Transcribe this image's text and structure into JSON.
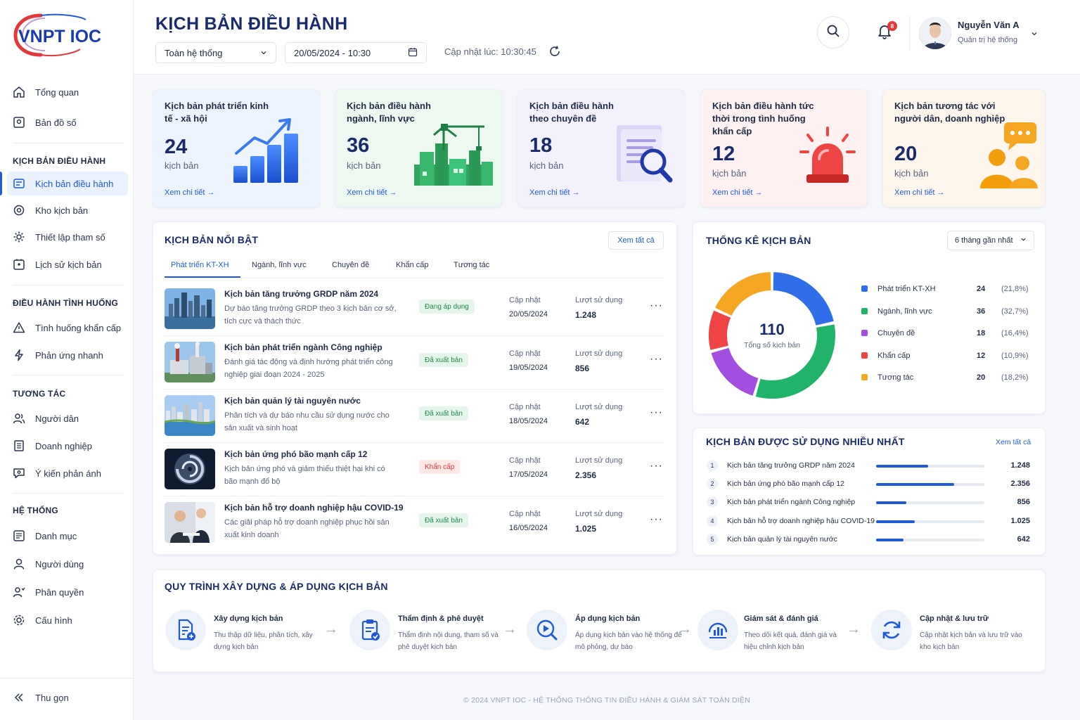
{
  "brand": {
    "logo_text": "VNPT IOC",
    "colors": {
      "primary": "#1f5bd8",
      "navy": "#1a2b6b",
      "logo_red": "#e5383b",
      "green": "#22b36b",
      "purple": "#a24fe0",
      "red": "#ef4444",
      "orange": "#f5a623"
    }
  },
  "sidebar": {
    "items_top": [
      {
        "label": "Tổng quan",
        "icon": "home-icon"
      },
      {
        "label": "Bản đồ số",
        "icon": "map-icon"
      }
    ],
    "sections": [
      {
        "title": "KỊCH BẢN ĐIỀU HÀNH",
        "items": [
          {
            "label": "Kịch bản điều hành",
            "icon": "scenario-icon",
            "active": true
          },
          {
            "label": "Kho kịch bản",
            "icon": "archive-icon"
          },
          {
            "label": "Thiết lập tham số",
            "icon": "settings-icon"
          },
          {
            "label": "Lịch sử kịch bản",
            "icon": "history-icon"
          }
        ]
      },
      {
        "title": "ĐIỀU HÀNH TÌNH HUỐNG",
        "items": [
          {
            "label": "Tình huống khẩn cấp",
            "icon": "warning-icon"
          },
          {
            "label": "Phản ứng nhanh",
            "icon": "lightning-icon"
          }
        ]
      },
      {
        "title": "TƯƠNG TÁC",
        "items": [
          {
            "label": "Người dân",
            "icon": "users-icon"
          },
          {
            "label": "Doanh nghiệp",
            "icon": "building-icon"
          },
          {
            "label": "Ý kiến phản ánh",
            "icon": "feedback-icon"
          }
        ]
      },
      {
        "title": "HỆ THỐNG",
        "items": [
          {
            "label": "Danh mục",
            "icon": "list-icon"
          },
          {
            "label": "Người dùng",
            "icon": "user-icon"
          },
          {
            "label": "Phân quyền",
            "icon": "permission-icon"
          },
          {
            "label": "Cấu hình",
            "icon": "gear-icon"
          }
        ]
      }
    ],
    "collapse_label": "Thu gọn"
  },
  "header": {
    "title": "KỊCH BẢN ĐIỀU HÀNH",
    "scope_select": "Toàn hệ thống",
    "datetime": "20/05/2024 - 10:30",
    "updated_text": "Cập nhật lúc: 10:30:45",
    "notification_count": "8",
    "user": {
      "name": "Nguyễn Văn A",
      "role": "Quản trị hệ thống"
    }
  },
  "stat_cards": [
    {
      "title": "Kịch bản phát triển kinh tế - xã hội",
      "value": "24",
      "unit": "kịch bản",
      "link": "Xem chi tiết",
      "bg": "#eef4fd",
      "art": "growth-chart-icon"
    },
    {
      "title": "Kịch bản điều hành ngành, lĩnh vực",
      "value": "36",
      "unit": "kịch bản",
      "link": "Xem chi tiết",
      "bg": "#edf8f1",
      "art": "industry-icon"
    },
    {
      "title": "Kịch bản điều hành theo chuyên đề",
      "value": "18",
      "unit": "kịch bản",
      "link": "Xem chi tiết",
      "bg": "#f3f1fc",
      "art": "document-search-icon"
    },
    {
      "title": "Kịch bản điều hành tức thời trong tình huống khẩn cấp",
      "value": "12",
      "unit": "kịch bản",
      "link": "Xem chi tiết",
      "bg": "#fdf1f1",
      "art": "siren-icon"
    },
    {
      "title": "Kịch bản tương tác với người dân, doanh nghiệp",
      "value": "20",
      "unit": "kịch bản",
      "link": "Xem chi tiết",
      "bg": "#fdf6ec",
      "art": "chat-people-icon"
    }
  ],
  "featured": {
    "title": "KỊCH BẢN NỔI BẬT",
    "view_all": "Xem tất cả",
    "tabs": [
      "Phát triển KT-XH",
      "Ngành, lĩnh vực",
      "Chuyên đề",
      "Khẩn cấp",
      "Tương tác"
    ],
    "updated_label": "Cập nhật",
    "usage_label": "Lượt sử dụng",
    "rows": [
      {
        "title": "Kịch bản tăng trưởng GRDP năm 2024",
        "desc": "Dự báo tăng trưởng GRDP theo 3 kịch bản cơ sở, tích cực và thách thức",
        "status": "Đang áp dụng",
        "status_color": "green",
        "date": "20/05/2024",
        "usage": "1.248",
        "thumb": "city-skyline-thumb"
      },
      {
        "title": "Kịch bản phát triển ngành Công nghiệp",
        "desc": "Đánh giá tác động và định hướng phát triển công nghiệp giai đoạn 2024 - 2025",
        "status": "Đã xuất bản",
        "status_color": "green",
        "date": "19/05/2024",
        "usage": "856",
        "thumb": "factory-thumb"
      },
      {
        "title": "Kịch bản quản lý tài nguyên nước",
        "desc": "Phân tích và dự báo nhu cầu sử dụng nước cho sản xuất và sinh hoạt",
        "status": "Đã xuất bản",
        "status_color": "green",
        "date": "18/05/2024",
        "usage": "642",
        "thumb": "river-city-thumb"
      },
      {
        "title": "Kịch bản ứng phó bão mạnh cấp 12",
        "desc": "Kịch bản ứng phó và giảm thiểu thiệt hại khi có bão mạnh đổ bộ",
        "status": "Khẩn cấp",
        "status_color": "red",
        "date": "17/05/2024",
        "usage": "2.356",
        "thumb": "storm-thumb"
      },
      {
        "title": "Kịch bản hỗ trợ doanh nghiệp hậu COVID-19",
        "desc": "Các giải pháp hỗ trợ doanh nghiệp phục hồi sản xuất kinh doanh",
        "status": "Đã xuất bản",
        "status_color": "green",
        "date": "16/05/2024",
        "usage": "1.025",
        "thumb": "business-meeting-thumb"
      }
    ]
  },
  "stats": {
    "title": "THỐNG KÊ KỊCH BẢN",
    "period": "6 tháng gần nhất",
    "total": "110",
    "total_label": "Tổng số kịch bản"
  },
  "chart_data": {
    "type": "pie",
    "categories": [
      "Phát triển KT-XH",
      "Ngành, lĩnh vực",
      "Chuyên đề",
      "Khẩn cấp",
      "Tương tác"
    ],
    "values": [
      24,
      36,
      18,
      12,
      20
    ],
    "percent_labels": [
      "(21,8%)",
      "(32,7%)",
      "(16,4%)",
      "(10,9%)",
      "(18,2%)"
    ],
    "colors": [
      "#2f6ee8",
      "#22b36b",
      "#a24fe0",
      "#ef4444",
      "#f5a623"
    ],
    "legend": "right"
  },
  "most_used": {
    "title": "KỊCH BẢN ĐƯỢC SỬ DỤNG NHIỀU NHẤT",
    "view_all": "Xem tất cả",
    "items": [
      {
        "rank": "1",
        "label": "Kịch bản tăng trưởng GRDP năm 2024",
        "value": "1.248",
        "ratio": 0.48
      },
      {
        "rank": "2",
        "label": "Kịch bản ứng phó bão mạnh cấp 12",
        "value": "2.356",
        "ratio": 0.72
      },
      {
        "rank": "3",
        "label": "Kịch bản phát triển ngành Công nghiệp",
        "value": "856",
        "ratio": 0.28
      },
      {
        "rank": "4",
        "label": "Kịch bản hỗ trợ doanh nghiệp hậu COVID-19",
        "value": "1.025",
        "ratio": 0.36
      },
      {
        "rank": "5",
        "label": "Kịch bản quản lý tài nguyên nước",
        "value": "642",
        "ratio": 0.25
      }
    ]
  },
  "process": {
    "title": "QUY TRÌNH XÂY DỰNG & ÁP DỤNG KỊCH BẢN",
    "steps": [
      {
        "title": "Xây dựng kịch bản",
        "desc": "Thu thập dữ liệu, phân tích, xây dựng kịch bản",
        "icon": "document-add-icon"
      },
      {
        "title": "Thẩm định & phê duyệt",
        "desc": "Thẩm định nội dung, tham số và phê duyệt kịch bản",
        "icon": "clipboard-check-icon"
      },
      {
        "title": "Áp dụng kịch bản",
        "desc": "Áp dụng kịch bản vào hệ thống để mô phỏng, dự báo",
        "icon": "play-search-icon"
      },
      {
        "title": "Giám sát & đánh giá",
        "desc": "Theo dõi kết quả, đánh giá và hiệu chỉnh kịch bản",
        "icon": "monitor-chart-icon"
      },
      {
        "title": "Cập nhật & lưu trữ",
        "desc": "Cập nhật kịch bản và lưu trữ vào kho kịch bản",
        "icon": "refresh-icon"
      }
    ]
  },
  "footer": "© 2024 VNPT IOC - HỆ THỐNG THÔNG TIN ĐIỀU HÀNH & GIÁM SÁT TOÀN DIỆN"
}
